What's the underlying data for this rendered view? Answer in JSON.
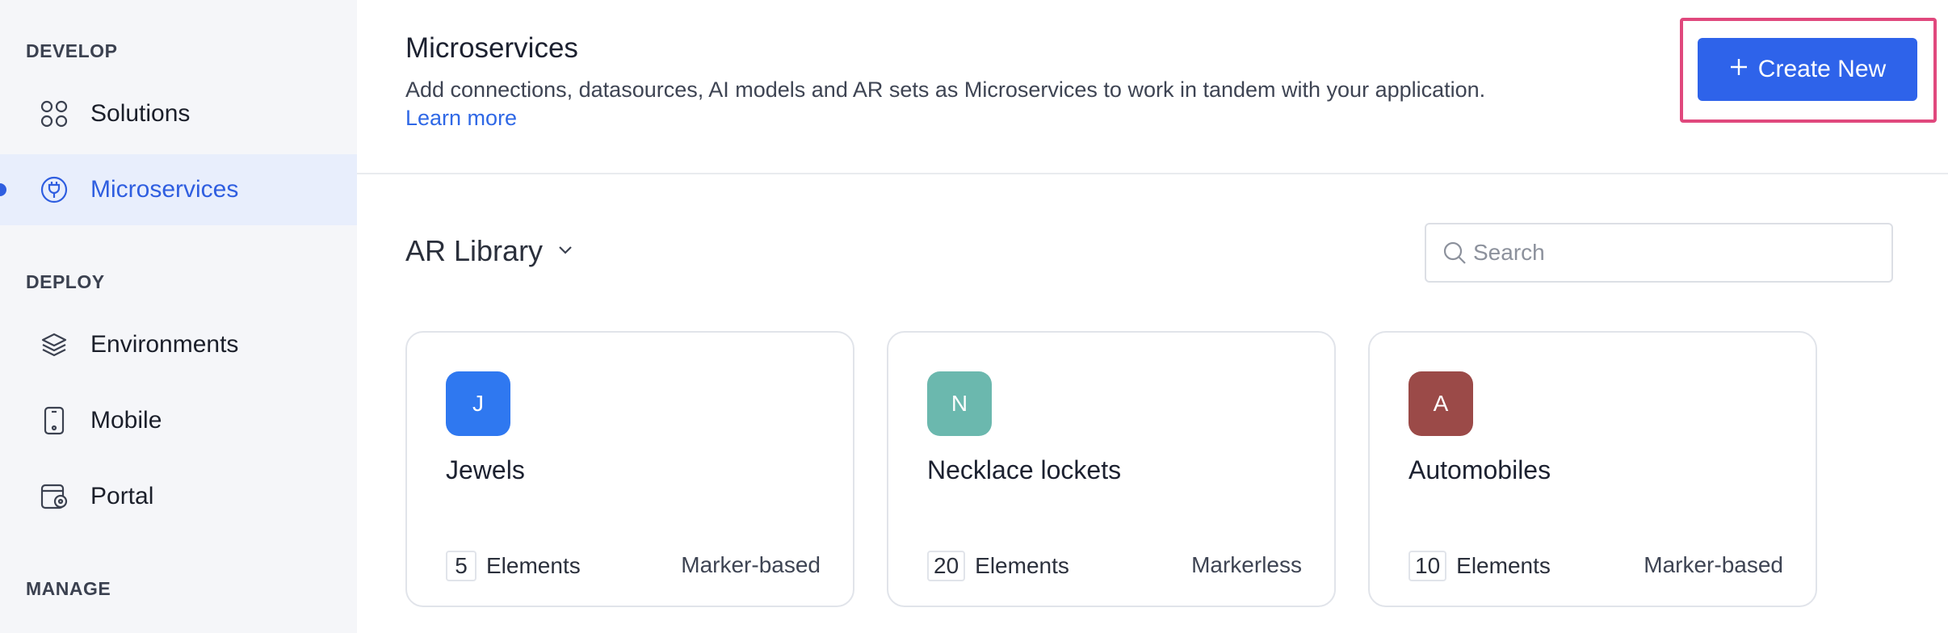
{
  "sidebar": {
    "sections": [
      {
        "title": "DEVELOP"
      },
      {
        "title": "DEPLOY"
      },
      {
        "title": "MANAGE"
      }
    ],
    "items": [
      {
        "label": "Solutions",
        "icon": "grid-icon"
      },
      {
        "label": "Microservices",
        "icon": "plug-icon",
        "active": true
      },
      {
        "label": "Environments",
        "icon": "layers-icon"
      },
      {
        "label": "Mobile",
        "icon": "mobile-icon"
      },
      {
        "label": "Portal",
        "icon": "portal-icon"
      }
    ]
  },
  "header": {
    "title": "Microservices",
    "description": "Add connections, datasources, AI models and AR sets as Microservices to work in tandem with your application.",
    "learn_more": "Learn more",
    "create_button": "Create New"
  },
  "library": {
    "title": "AR Library",
    "search_placeholder": "Search"
  },
  "cards": [
    {
      "initial": "J",
      "name": "Jewels",
      "count": "5",
      "count_label": "Elements",
      "type": "Marker-based",
      "color": "#2f78f0"
    },
    {
      "initial": "N",
      "name": "Necklace lockets",
      "count": "20",
      "count_label": "Elements",
      "type": "Markerless",
      "color": "#6bb8ae"
    },
    {
      "initial": "A",
      "name": "Automobiles",
      "count": "10",
      "count_label": "Elements",
      "type": "Marker-based",
      "color": "#9b4a48"
    }
  ],
  "colors": {
    "accent": "#2e63ea",
    "highlight": "#e0487d",
    "sidebar_bg": "#f5f6f9",
    "active_bg": "#e8eefc"
  }
}
